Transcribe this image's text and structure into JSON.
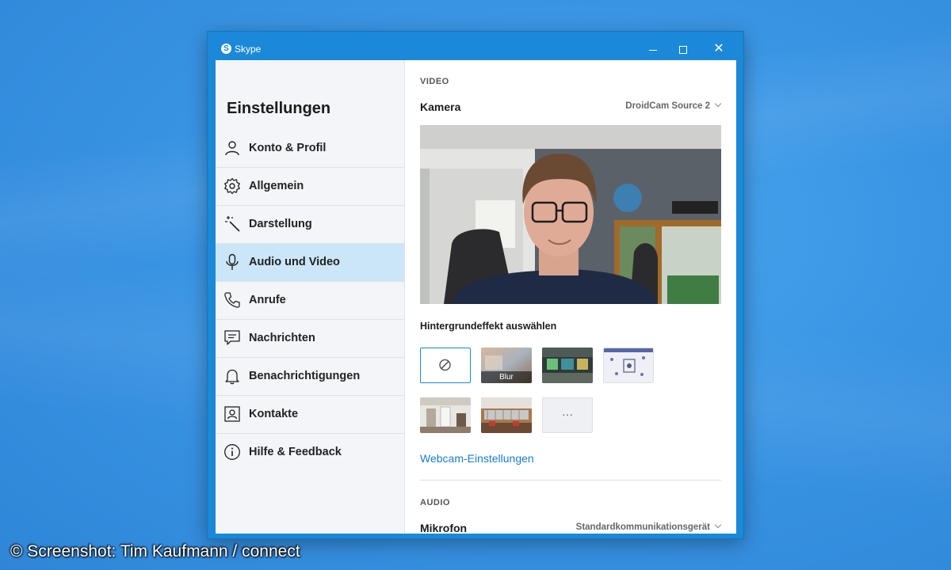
{
  "window": {
    "title": "Skype",
    "logo_letter": "S"
  },
  "sidebar": {
    "title": "Einstellungen",
    "items": [
      {
        "label": "Konto & Profil",
        "icon": "person-icon"
      },
      {
        "label": "Allgemein",
        "icon": "gear-icon"
      },
      {
        "label": "Darstellung",
        "icon": "magic-wand-icon"
      },
      {
        "label": "Audio und Video",
        "icon": "microphone-icon",
        "active": true
      },
      {
        "label": "Anrufe",
        "icon": "phone-icon"
      },
      {
        "label": "Nachrichten",
        "icon": "message-icon"
      },
      {
        "label": "Benachrichtigungen",
        "icon": "bell-icon"
      },
      {
        "label": "Kontakte",
        "icon": "contact-card-icon"
      },
      {
        "label": "Hilfe & Feedback",
        "icon": "info-icon"
      }
    ]
  },
  "video": {
    "section_label": "VIDEO",
    "camera_label": "Kamera",
    "camera_value": "DroidCam Source 2",
    "background_label": "Hintergrundeffekt auswählen",
    "effects": [
      {
        "label": "",
        "kind": "none",
        "selected": true
      },
      {
        "label": "Blur",
        "kind": "blur"
      },
      {
        "label": "",
        "kind": "image-office"
      },
      {
        "label": "",
        "kind": "image-pattern"
      },
      {
        "label": "",
        "kind": "image-hall"
      },
      {
        "label": "",
        "kind": "image-cafe"
      },
      {
        "label": "···",
        "kind": "more"
      }
    ],
    "webcam_link": "Webcam-Einstellungen"
  },
  "audio": {
    "section_label": "AUDIO",
    "mic_label": "Mikrofon",
    "mic_value": "Standardkommunikationsgerät"
  },
  "credit": "© Screenshot: Tim Kaufmann / connect",
  "colors": {
    "accent": "#1b88d8",
    "sidebar_active": "#cbe6f9",
    "link": "#1b7bd0"
  }
}
